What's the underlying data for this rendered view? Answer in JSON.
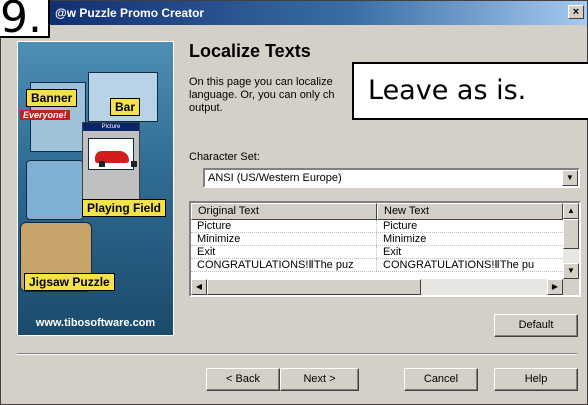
{
  "window": {
    "title": "@w Puzzle Promo Creator",
    "close_label": "×"
  },
  "step_callout": "9.",
  "side_banner": {
    "labels": {
      "banner": "Banner",
      "bar": "Bar",
      "playing_field": "Playing Field",
      "jigsaw": "Jigsaw Puzzle",
      "everyone": "Everyone!",
      "picture_window": "Picture"
    },
    "url": "www.tibosoftware.com"
  },
  "page": {
    "title": "Localize Texts",
    "description": "On this page you can localize language. Or, you can only ch output."
  },
  "callout": "Leave as is.",
  "charset": {
    "label": "Character Set:",
    "value": "ANSI (US/Western Europe)"
  },
  "table": {
    "columns": [
      "Original Text",
      "New Text"
    ],
    "rows": [
      [
        "Picture",
        "Picture"
      ],
      [
        "Minimize",
        "Minimize"
      ],
      [
        "Exit",
        "Exit"
      ],
      [
        "CONGRATULATIONS!ⅡThe puz",
        "CONGRATULATIONS!ⅡThe pu"
      ]
    ]
  },
  "buttons": {
    "default": "Default",
    "back": "< Back",
    "next": "Next >",
    "cancel": "Cancel",
    "help": "Help"
  },
  "icons": {
    "combo_arrow": "▼",
    "up_arrow": "▲",
    "down_arrow": "▼",
    "left_arrow": "◀",
    "right_arrow": "▶"
  }
}
